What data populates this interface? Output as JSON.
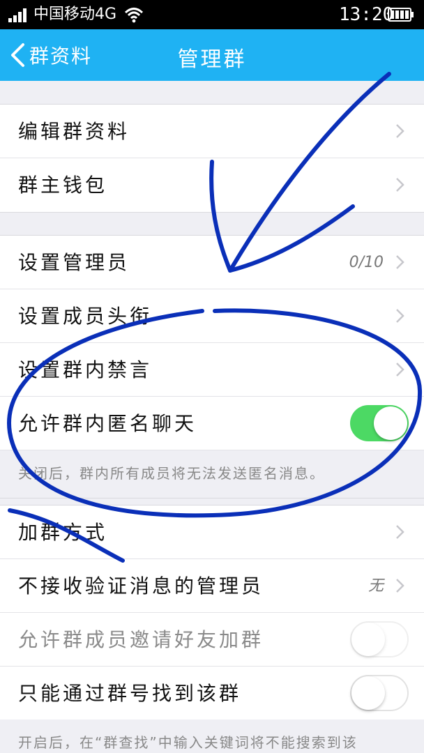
{
  "status_bar": {
    "carrier": "中国移动4G",
    "time": "13:20"
  },
  "nav": {
    "back_label": "群资料",
    "title": "管理群"
  },
  "group1": [
    {
      "label": "编辑群资料"
    },
    {
      "label": "群主钱包"
    }
  ],
  "group2": [
    {
      "label": "设置管理员",
      "value": "0/10"
    },
    {
      "label": "设置成员头衔"
    },
    {
      "label": "设置群内禁言"
    },
    {
      "label": "允许群内匿名聊天",
      "toggle": "on"
    }
  ],
  "group2_note": "关闭后，群内所有成员将无法发送匿名消息。",
  "group3": [
    {
      "label": "加群方式"
    },
    {
      "label": "不接收验证消息的管理员",
      "value": "无"
    },
    {
      "label": "允许群成员邀请好友加群",
      "toggle": "off"
    },
    {
      "label": "只能通过群号找到该群",
      "toggle": "off"
    }
  ],
  "group3_note": "开启后，在“群查找”中输入关键词将不能搜索到该",
  "colors": {
    "nav_bg": "#1fb2f3",
    "toggle_on": "#4cd964",
    "annotation_ink": "#0a2fb8"
  }
}
